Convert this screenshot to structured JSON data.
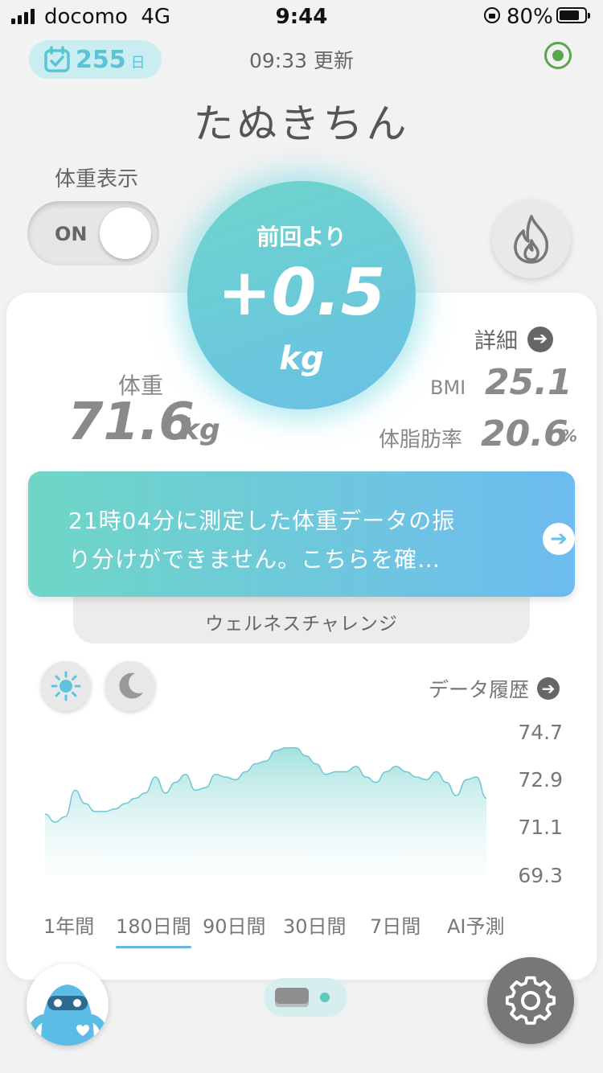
{
  "status_bar": {
    "carrier": "docomo",
    "network": "4G",
    "time": "9:44",
    "battery": "80%"
  },
  "header": {
    "streak_days": "255",
    "streak_unit": "日",
    "updated": "09:33 更新",
    "username": "たぬきちん"
  },
  "toggle": {
    "label": "体重表示",
    "state": "ON"
  },
  "bubble": {
    "label": "前回より",
    "value": "+0.5",
    "unit": "kg"
  },
  "stats": {
    "detail_label": "詳細",
    "weight_label": "体重",
    "weight_value": "71.6",
    "weight_unit": "kg",
    "bmi_label": "BMI",
    "bmi_value": "25.1",
    "fat_label": "体脂肪率",
    "fat_value": "20.6",
    "fat_unit": "%"
  },
  "notice": {
    "line1": "21時04分に測定した体重データの振",
    "line2": "り分けができません。こちらを確…"
  },
  "challenge": {
    "label": "ウェルネスチャレンジ"
  },
  "history": {
    "label": "データ履歴"
  },
  "chart_data": {
    "type": "area",
    "title": "",
    "xlabel": "",
    "ylabel": "",
    "y_ticks": [
      "74.7",
      "72.9",
      "71.1",
      "69.3"
    ],
    "ylim": [
      69.3,
      74.7
    ],
    "grid": false,
    "color": "#8fd6dc",
    "values": [
      71.6,
      71.3,
      71.5,
      72.5,
      72.0,
      71.7,
      71.7,
      71.8,
      72.0,
      72.2,
      72.4,
      73.0,
      72.4,
      72.8,
      73.1,
      72.5,
      72.6,
      73.1,
      73.0,
      72.9,
      73.2,
      73.5,
      73.6,
      74.0,
      74.1,
      74.1,
      73.8,
      73.5,
      73.1,
      73.2,
      73.2,
      73.4,
      73.0,
      72.8,
      73.2,
      73.4,
      73.2,
      73.0,
      72.9,
      73.2,
      72.8,
      72.3,
      72.9,
      73.0,
      72.2
    ]
  },
  "ranges": [
    "1年間",
    "180日間",
    "90日間",
    "30日間",
    "7日間",
    "AI予測"
  ],
  "active_range": "180日間",
  "colors": {
    "accent_teal": "#6ed5cb",
    "accent_blue": "#69c0e6",
    "settings_bg": "#777777"
  }
}
